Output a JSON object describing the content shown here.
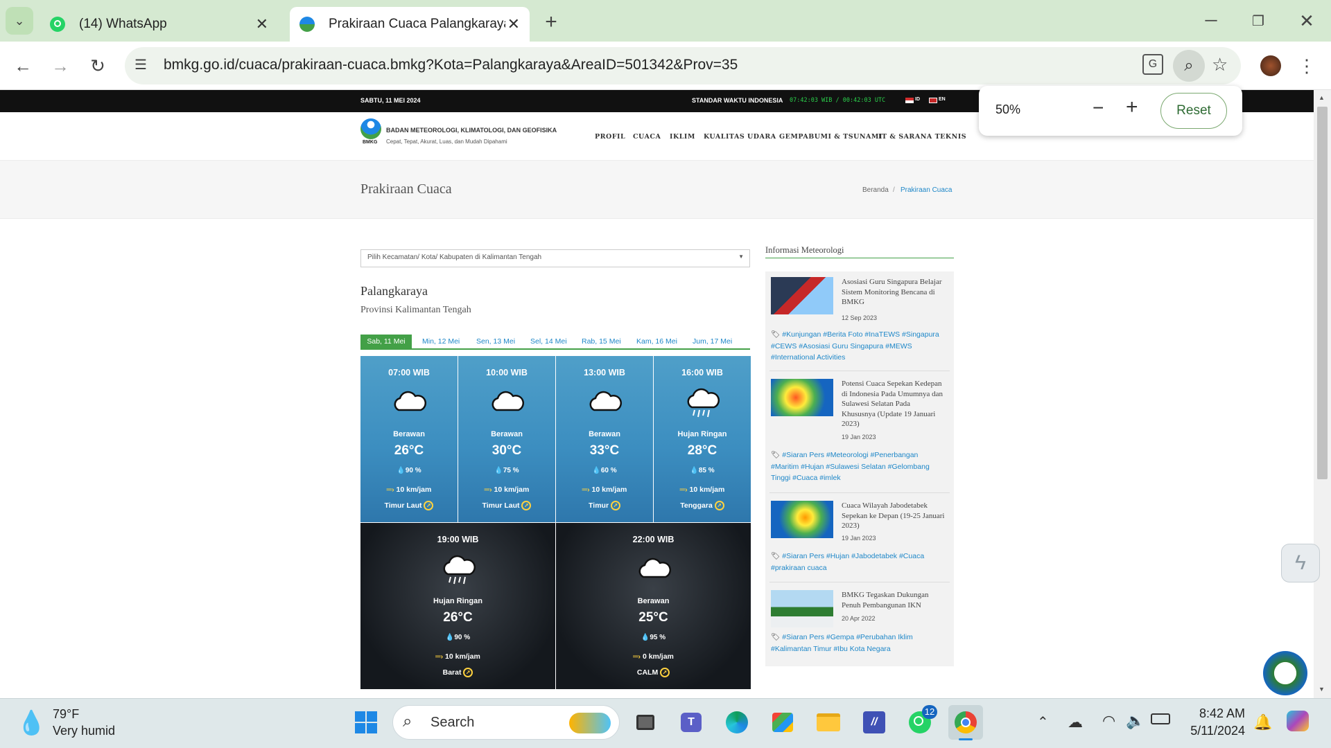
{
  "browser": {
    "tabs": [
      {
        "label": "(14) WhatsApp"
      },
      {
        "label": "Prakiraan Cuaca Palangkaraya -"
      }
    ],
    "url": "bmkg.go.id/cuaca/prakiraan-cuaca.bmkg?Kota=Palangkaraya&AreaID=501342&Prov=35",
    "zoom": {
      "value": "50%",
      "reset_label": "Reset"
    }
  },
  "site": {
    "date": "SABTU, 11 MEI 2024",
    "time_label": "STANDAR WAKTU INDONESIA",
    "time_value": "07:42:03 WIB / 00:42:03 UTC",
    "lang_id": "ID",
    "lang_en": "EN",
    "org_name": "BADAN METEOROLOGI, KLIMATOLOGI, DAN GEOFISIKA",
    "tagline": "Cepat, Tepat, Akurat, Luas, dan Mudah Dipahami",
    "logo_text": "BMKG",
    "nav": [
      "PROFIL",
      "CUACA",
      "IKLIM",
      "KUALITAS UDARA",
      "GEMPABUMI & TSUNAMI",
      "IT & SARANA TEKNIS"
    ],
    "page_title": "Prakiraan Cuaca",
    "breadcrumb": {
      "home": "Beranda",
      "sep": "/",
      "current": "Prakiraan Cuaca"
    }
  },
  "forecast": {
    "select_placeholder": "Pilih Kecamatan/ Kota/ Kabupaten di Kalimantan Tengah",
    "city": "Palangkaraya",
    "province": "Provinsi Kalimantan Tengah",
    "days": [
      "Sab, 11 Mei",
      "Min, 12 Mei",
      "Sen, 13 Mei",
      "Sel, 14 Mei",
      "Rab, 15 Mei",
      "Kam, 16 Mei",
      "Jum, 17 Mei"
    ],
    "slots": [
      {
        "time": "07:00 WIB",
        "cond": "Berawan",
        "temp": "26°C",
        "hum": "90 %",
        "wind": "10 km/jam",
        "dir": "Timur Laut",
        "icon": "cloud-icon"
      },
      {
        "time": "10:00 WIB",
        "cond": "Berawan",
        "temp": "30°C",
        "hum": "75 %",
        "wind": "10 km/jam",
        "dir": "Timur Laut",
        "icon": "cloud-icon"
      },
      {
        "time": "13:00 WIB",
        "cond": "Berawan",
        "temp": "33°C",
        "hum": "60 %",
        "wind": "10 km/jam",
        "dir": "Timur",
        "icon": "cloud-icon"
      },
      {
        "time": "16:00 WIB",
        "cond": "Hujan Ringan",
        "temp": "28°C",
        "hum": "85 %",
        "wind": "10 km/jam",
        "dir": "Tenggara",
        "icon": "rain-cloud-icon"
      },
      {
        "time": "19:00 WIB",
        "cond": "Hujan Ringan",
        "temp": "26°C",
        "hum": "90 %",
        "wind": "10 km/jam",
        "dir": "Barat",
        "icon": "rain-cloud-icon"
      },
      {
        "time": "22:00 WIB",
        "cond": "Berawan",
        "temp": "25°C",
        "hum": "95 %",
        "wind": "0 km/jam",
        "dir": "CALM",
        "icon": "cloud-icon"
      }
    ]
  },
  "sidebar": {
    "title": "Informasi Meteorologi",
    "news": [
      {
        "title": "Asosiasi Guru Singapura Belajar Sistem Monitoring Bencana di BMKG",
        "date": "12 Sep 2023",
        "tags": "#Kunjungan #Berita Foto #InaTEWS #Singapura #CEWS #Asosiasi Guru Singapura #MEWS #International Activities"
      },
      {
        "title": "Potensi Cuaca Sepekan Kedepan di Indonesia Pada Umumnya dan Sulawesi Selatan Pada Khususnya (Update 19 Januari 2023)",
        "date": "19 Jan 2023",
        "tags": "#Siaran Pers #Meteorologi #Penerbangan #Maritim #Hujan #Sulawesi Selatan #Gelombang Tinggi #Cuaca #imlek"
      },
      {
        "title": "Cuaca Wilayah Jabodetabek Sepekan ke Depan (19-25 Januari 2023)",
        "date": "19 Jan 2023",
        "tags": "#Siaran Pers #Hujan #Jabodetabek #Cuaca #prakiraan cuaca"
      },
      {
        "title": "BMKG Tegaskan Dukungan Penuh Pembangunan IKN",
        "date": "20 Apr 2022",
        "tags": "#Siaran Pers #Gempa #Perubahan Iklim #Kalimantan Timur #Ibu Kota Negara"
      }
    ]
  },
  "taskbar": {
    "weather_temp": "79°F",
    "weather_desc": "Very humid",
    "search_label": "Search",
    "whatsapp_badge": "12",
    "time": "8:42 AM",
    "date": "5/11/2024"
  },
  "colors": {
    "accent_green": "#43a047",
    "link_blue": "#1e87c8",
    "tab_bar": "#d5e9d1"
  }
}
